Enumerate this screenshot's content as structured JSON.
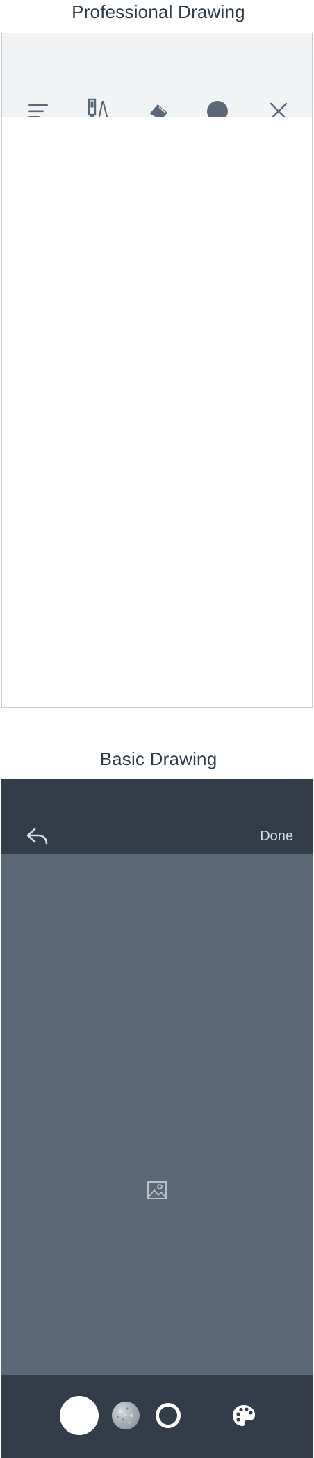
{
  "professional": {
    "title": "Professional Drawing",
    "toolbar": {
      "icons": [
        "menu-icon",
        "pencil-ruler-icon",
        "eraser-icon",
        "color-dot-icon",
        "close-icon"
      ]
    },
    "colors": {
      "toolbar_bg": "#f2f3f5",
      "icon": "#5b6878",
      "canvas_bg": "#ffffff"
    }
  },
  "basic": {
    "title": "Basic Drawing",
    "header": {
      "undo_icon": "undo-icon",
      "done_label": "Done"
    },
    "canvas": {
      "placeholder_icon": "image-icon"
    },
    "bottom_toolbar": {
      "icons": [
        "brush-size-large",
        "texture-brush",
        "outline-brush",
        "palette-icon"
      ]
    },
    "colors": {
      "header_bg": "#333d4a",
      "canvas_bg": "#5b6878",
      "text": "#d8dde3"
    }
  }
}
